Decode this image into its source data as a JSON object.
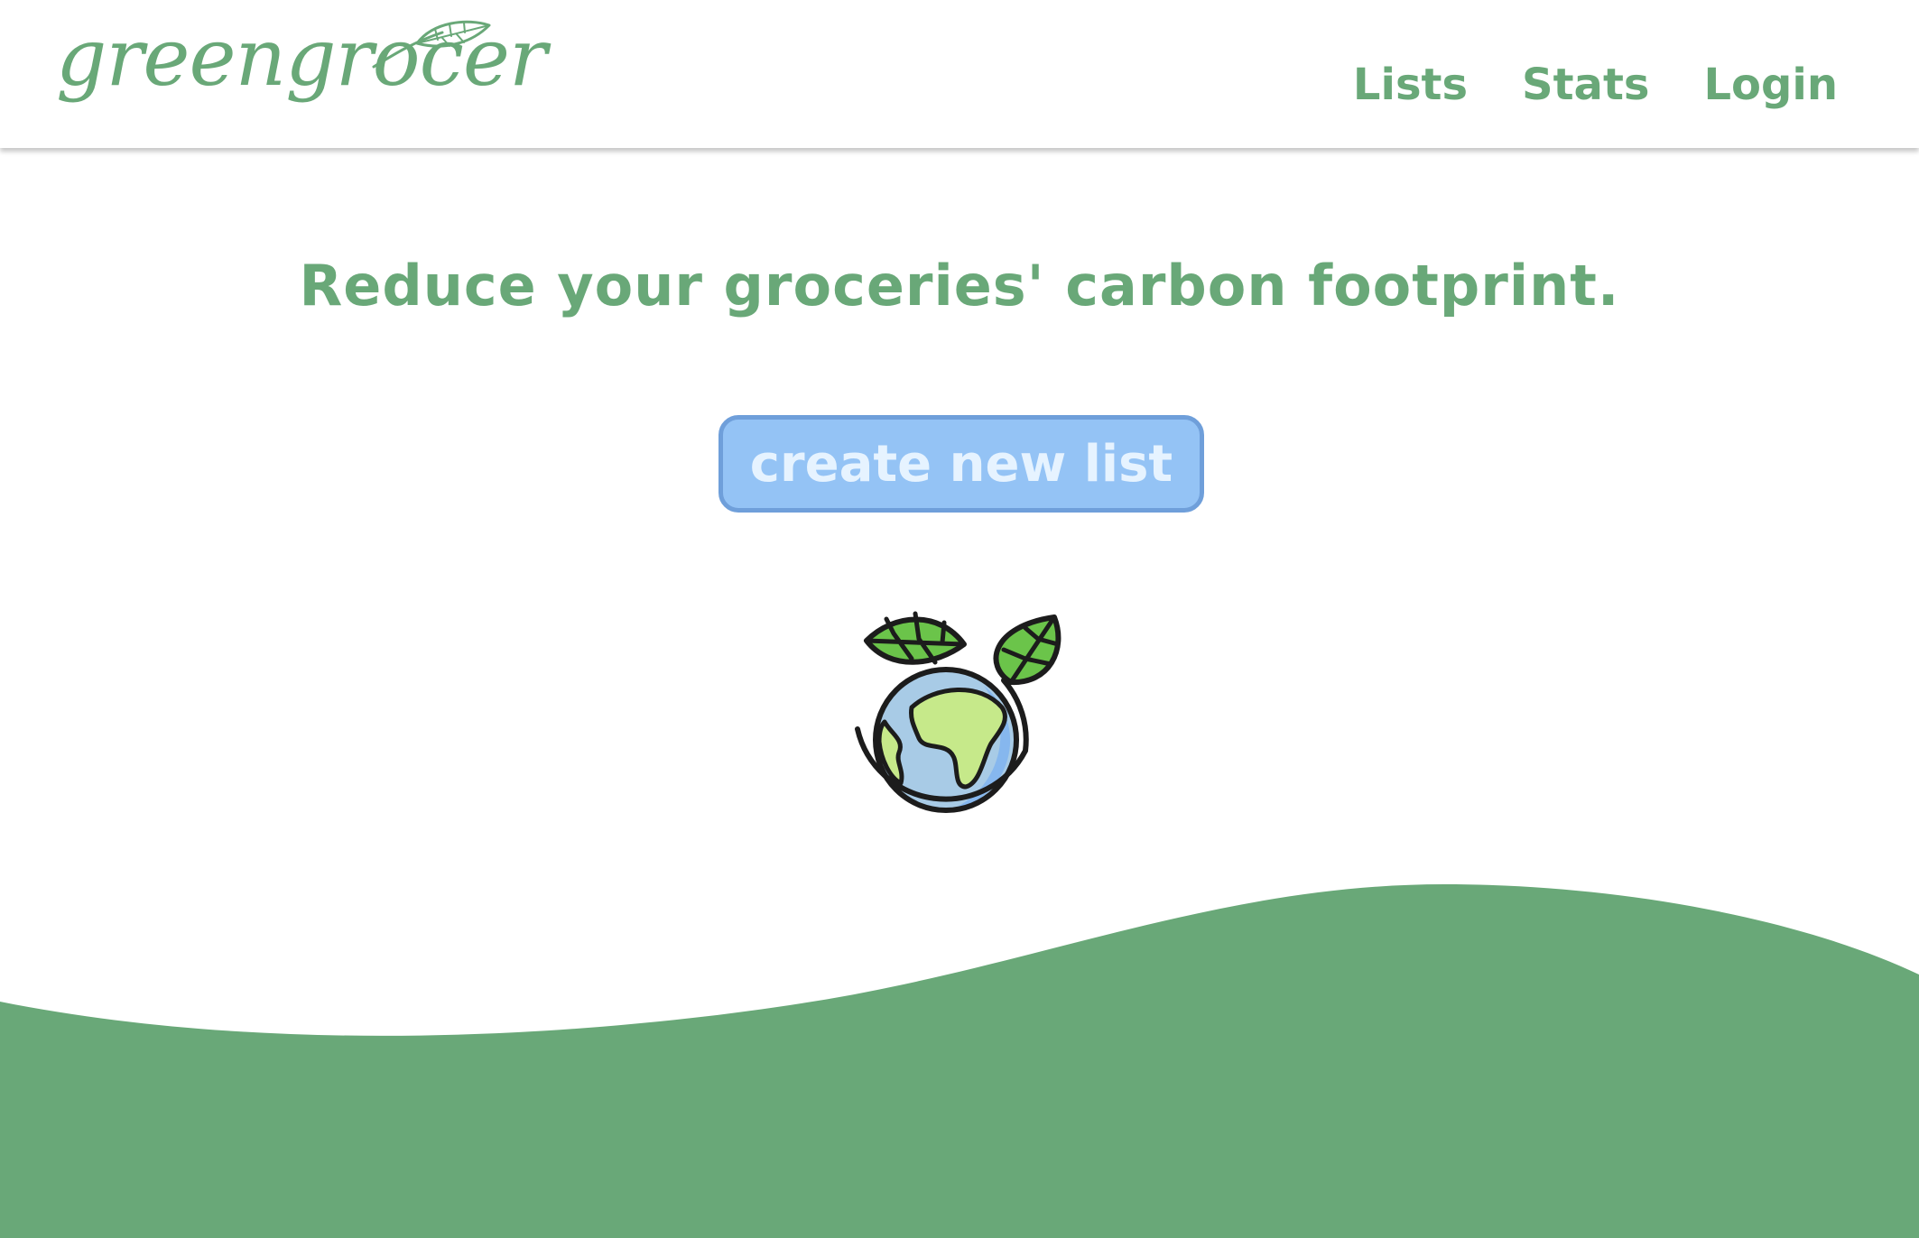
{
  "brand": {
    "name": "greengrocer",
    "logo_color": "#69a878"
  },
  "nav": {
    "items": [
      {
        "label": "Lists"
      },
      {
        "label": "Stats"
      },
      {
        "label": "Login"
      }
    ],
    "color": "#69a878"
  },
  "hero": {
    "headline": "Reduce your groceries' carbon footprint.",
    "cta_label": "create new list",
    "illustration": "earth-with-leaves-icon"
  },
  "colors": {
    "brand_green": "#69a878",
    "button_fill": "#94c3f5",
    "button_border": "#6f9fda",
    "button_text": "#e6f3ff",
    "wave_green": "#69a878"
  }
}
